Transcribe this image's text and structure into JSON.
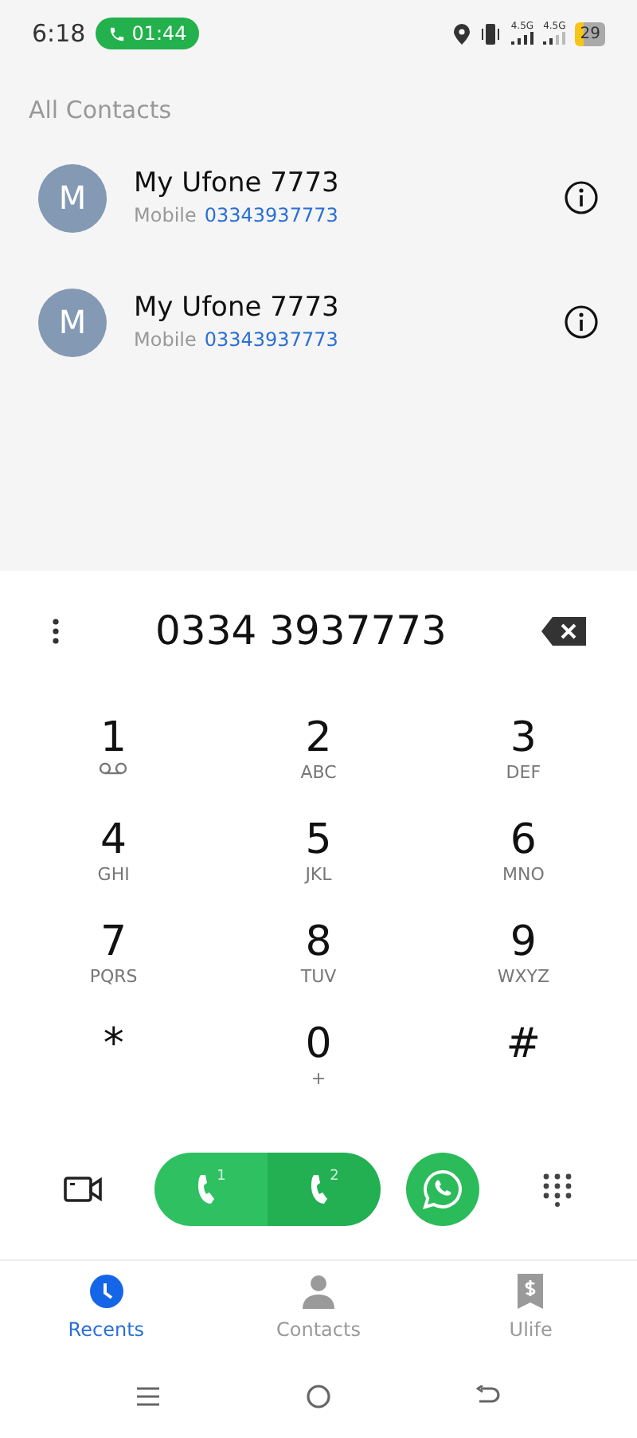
{
  "status_bar": {
    "time": "6:18",
    "call_timer": "01:44",
    "network_1": "4.5G",
    "network_2": "4.5G",
    "battery": "29"
  },
  "section_title": "All Contacts",
  "contacts": [
    {
      "initial": "M",
      "name": "My Ufone 7773",
      "type": "Mobile",
      "number": "03343937773"
    },
    {
      "initial": "M",
      "name": "My Ufone 7773",
      "type": "Mobile",
      "number": "03343937773"
    }
  ],
  "dialed_number": "0334 3937773",
  "keys": [
    {
      "digit": "1",
      "kind": "voicemail"
    },
    {
      "digit": "2",
      "kind": "letters",
      "letters": "ABC"
    },
    {
      "digit": "3",
      "kind": "letters",
      "letters": "DEF"
    },
    {
      "digit": "4",
      "kind": "letters",
      "letters": "GHI"
    },
    {
      "digit": "5",
      "kind": "letters",
      "letters": "JKL"
    },
    {
      "digit": "6",
      "kind": "letters",
      "letters": "MNO"
    },
    {
      "digit": "7",
      "kind": "letters",
      "letters": "PQRS"
    },
    {
      "digit": "8",
      "kind": "letters",
      "letters": "TUV"
    },
    {
      "digit": "9",
      "kind": "letters",
      "letters": "WXYZ"
    },
    {
      "digit": "*",
      "kind": "plain"
    },
    {
      "digit": "0",
      "kind": "letters",
      "letters": "+"
    },
    {
      "digit": "#",
      "kind": "plain"
    }
  ],
  "sim_buttons": [
    {
      "sim": "1"
    },
    {
      "sim": "2"
    }
  ],
  "tabs": [
    {
      "label": "Recents",
      "kind": "clock",
      "selected": true
    },
    {
      "label": "Contacts",
      "kind": "person",
      "selected": false
    },
    {
      "label": "Ulife",
      "kind": "wallet",
      "selected": false
    }
  ]
}
